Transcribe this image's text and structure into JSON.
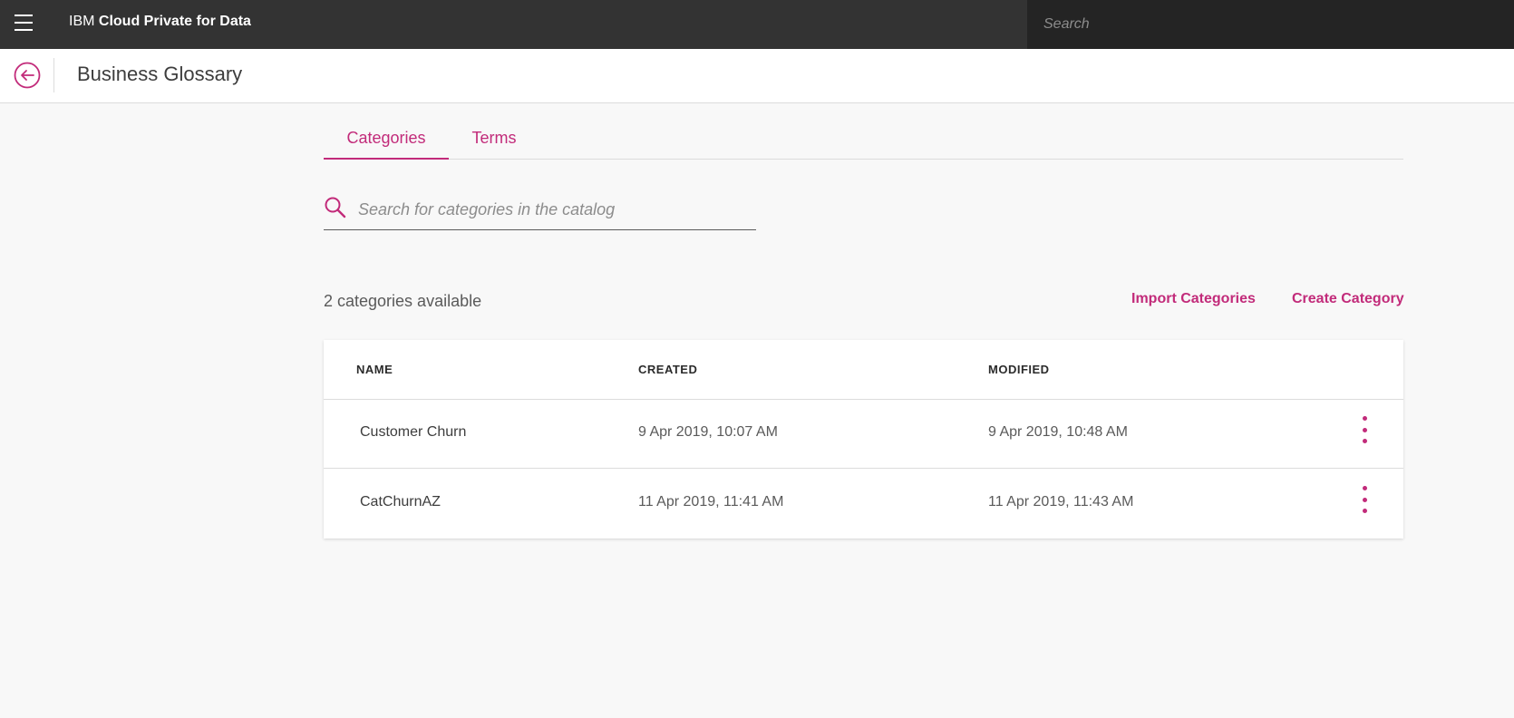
{
  "topbar": {
    "brand_prefix": "IBM",
    "brand_name": "Cloud Private for Data",
    "search_placeholder": "Search"
  },
  "subheader": {
    "title": "Business Glossary"
  },
  "tabs": [
    {
      "label": "Categories",
      "active": true
    },
    {
      "label": "Terms",
      "active": false
    }
  ],
  "search": {
    "placeholder": "Search for categories in the catalog",
    "value": ""
  },
  "summary": {
    "count_text": "2 categories available"
  },
  "actions": {
    "import_label": "Import Categories",
    "create_label": "Create Category"
  },
  "table": {
    "columns": [
      "NAME",
      "CREATED",
      "MODIFIED"
    ],
    "rows": [
      {
        "name": "Customer Churn",
        "created": "9 Apr 2019, 10:07 AM",
        "modified": "9 Apr 2019, 10:48 AM"
      },
      {
        "name": "CatChurnAZ",
        "created": "11 Apr 2019, 11:41 AM",
        "modified": "11 Apr 2019, 11:43 AM"
      }
    ]
  },
  "icons": {
    "menu": "hamburger-menu-icon",
    "back": "arrow-left-circle-icon",
    "search": "magnifier-icon",
    "row_menu": "overflow-vertical-icon"
  },
  "colors": {
    "accent": "#c22b7a",
    "topbar": "#333333",
    "topbar_search": "#242424",
    "page_bg": "#f8f8f8"
  }
}
